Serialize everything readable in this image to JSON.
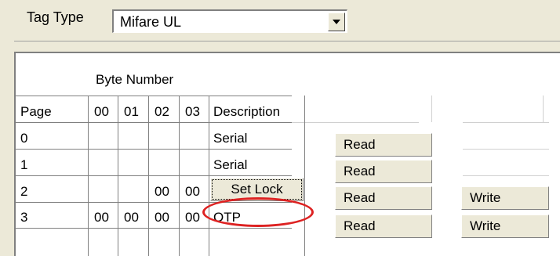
{
  "tag_type": {
    "label": "Tag Type",
    "value": "Mifare UL"
  },
  "grid": {
    "byte_number_label": "Byte Number",
    "headers": {
      "page": "Page",
      "b00": "00",
      "b01": "01",
      "b02": "02",
      "b03": "03",
      "description": "Description"
    },
    "rows": [
      {
        "page": "0",
        "b00": "",
        "b01": "",
        "b02": "",
        "b03": "",
        "description": "Serial",
        "read": "Read",
        "write": ""
      },
      {
        "page": "1",
        "b00": "",
        "b01": "",
        "b02": "",
        "b03": "",
        "description": "Serial",
        "read": "Read",
        "write": ""
      },
      {
        "page": "2",
        "b00": "",
        "b01": "",
        "b02": "00",
        "b03": "00",
        "description": "Set Lock",
        "read": "Read",
        "write": "Write"
      },
      {
        "page": "3",
        "b00": "00",
        "b01": "00",
        "b02": "00",
        "b03": "00",
        "description": "OTP",
        "read": "Read",
        "write": "Write"
      }
    ]
  },
  "annotation": {
    "color": "#dd2222"
  }
}
